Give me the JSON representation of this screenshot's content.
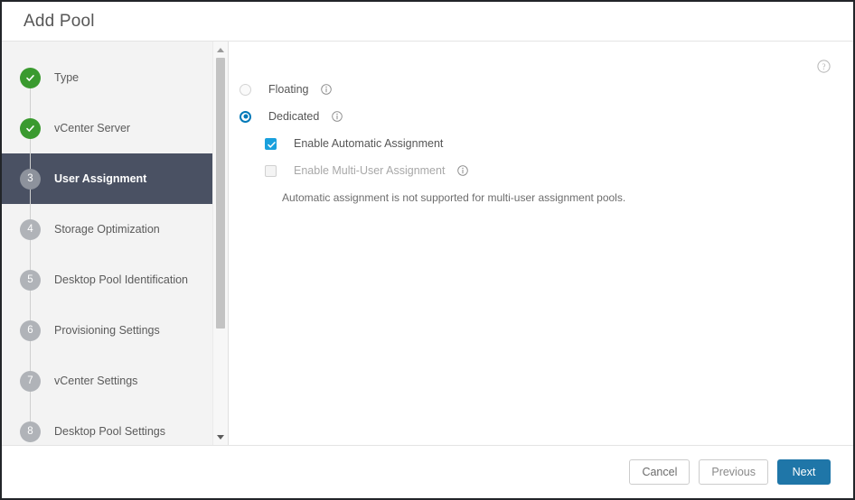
{
  "window": {
    "title": "Add Pool"
  },
  "help": {
    "icon": "help-circle-icon"
  },
  "sidebar": {
    "steps": [
      {
        "num": "1",
        "label": "Type",
        "state": "done"
      },
      {
        "num": "2",
        "label": "vCenter Server",
        "state": "done"
      },
      {
        "num": "3",
        "label": "User Assignment",
        "state": "active"
      },
      {
        "num": "4",
        "label": "Storage Optimization",
        "state": "pending"
      },
      {
        "num": "5",
        "label": "Desktop Pool Identification",
        "state": "pending"
      },
      {
        "num": "6",
        "label": "Provisioning Settings",
        "state": "pending"
      },
      {
        "num": "7",
        "label": "vCenter Settings",
        "state": "pending"
      },
      {
        "num": "8",
        "label": "Desktop Pool Settings",
        "state": "pending"
      }
    ],
    "scrollbar": {
      "up_arrow": "scroll-up-arrow-icon",
      "down_arrow": "scroll-down-arrow-icon"
    }
  },
  "main": {
    "options": [
      {
        "label": "Floating",
        "selected": false,
        "info": true
      },
      {
        "label": "Dedicated",
        "selected": true,
        "info": true
      }
    ],
    "checkboxes": [
      {
        "label": "Enable Automatic Assignment",
        "checked": true,
        "disabled": false,
        "info": false
      },
      {
        "label": "Enable Multi-User Assignment",
        "checked": false,
        "disabled": true,
        "info": true
      }
    ],
    "helper_text": "Automatic assignment is not supported for multi-user assignment pools."
  },
  "footer": {
    "cancel_label": "Cancel",
    "previous_label": "Previous",
    "next_label": "Next"
  },
  "colors": {
    "accent": "#0079b8",
    "primary_button": "#1f76a8",
    "checkbox_checked": "#19a0dd",
    "step_done": "#3a9a2f",
    "step_active_bg": "#4a5163",
    "sidebar_bg": "#f3f3f3"
  }
}
